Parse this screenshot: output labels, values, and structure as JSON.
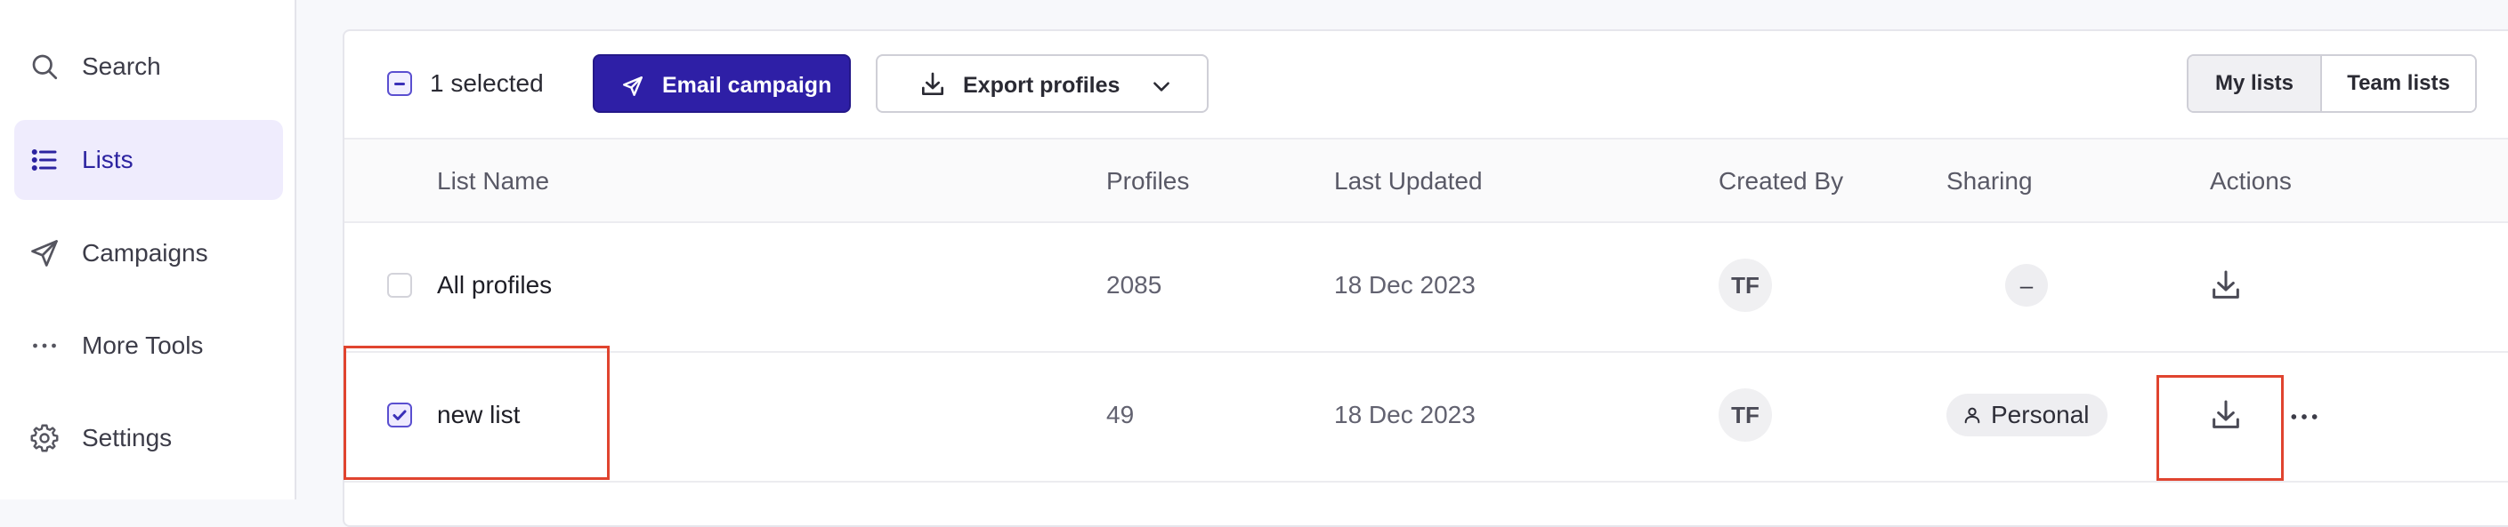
{
  "sidebar": {
    "items": [
      {
        "label": "Search",
        "icon": "search-icon",
        "active": false
      },
      {
        "label": "Lists",
        "icon": "list-icon",
        "active": true
      },
      {
        "label": "Campaigns",
        "icon": "send-icon",
        "active": false
      },
      {
        "label": "More Tools",
        "icon": "more-horizontal-icon",
        "active": false
      },
      {
        "label": "Settings",
        "icon": "gear-icon",
        "active": false
      }
    ]
  },
  "toolbar": {
    "selected_text": "1 selected",
    "email_campaign_label": "Email campaign",
    "export_profiles_label": "Export profiles",
    "my_lists_label": "My lists",
    "team_lists_label": "Team lists"
  },
  "table": {
    "columns": [
      "List Name",
      "Profiles",
      "Last Updated",
      "Created By",
      "Sharing",
      "Actions"
    ],
    "rows": [
      {
        "name": "All profiles",
        "profiles": "2085",
        "last_updated": "18 Dec 2023",
        "created_by": "TF",
        "sharing": "–",
        "checked": false
      },
      {
        "name": "new list",
        "profiles": "49",
        "last_updated": "18 Dec 2023",
        "created_by": "TF",
        "sharing": "Personal",
        "checked": true
      }
    ]
  },
  "colors": {
    "accent": "#2e1fa6",
    "active_nav_bg": "#efecfd",
    "highlight": "#e0442f"
  }
}
